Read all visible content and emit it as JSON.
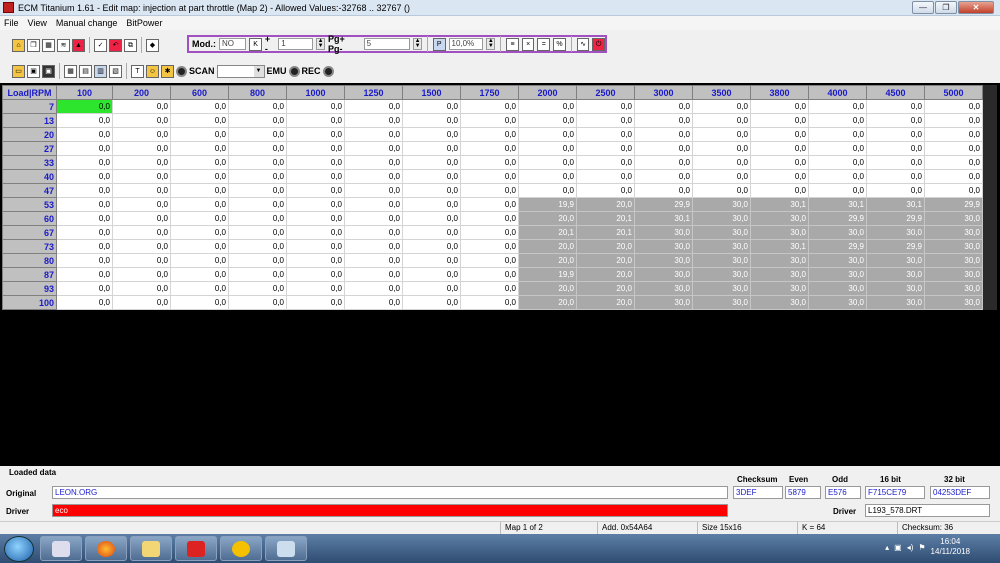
{
  "window": {
    "title": "ECM Titanium 1.61 - Edit map: injection at part throttle (Map 2) - Allowed Values:-32768 .. 32767 ()",
    "minimize": "—",
    "maximize": "❐",
    "close": "✕"
  },
  "menu": [
    "File",
    "View",
    "Manual change",
    "BitPower"
  ],
  "toolbar1": {
    "mod_label": "Mod.:",
    "mod_value": "NO",
    "k_label": "K",
    "plusminus_label": "+ -",
    "plusminus_value": "1",
    "pg_label": "Pg+ Pg-",
    "pg_value": "5",
    "p_label": "P",
    "percent_value": "10,0%"
  },
  "toolbar2": {
    "scan_label": "SCAN",
    "scan_value": "",
    "emu_label": "EMU",
    "rec_label": "REC"
  },
  "table": {
    "corner": "Load|RPM",
    "rpm": [
      "100",
      "200",
      "600",
      "800",
      "1000",
      "1250",
      "1500",
      "1750",
      "2000",
      "2500",
      "3000",
      "3500",
      "3800",
      "4000",
      "4500",
      "5000"
    ],
    "rows": [
      {
        "load": "7",
        "values": [
          "0,0",
          "0,0",
          "0,0",
          "0,0",
          "0,0",
          "0,0",
          "0,0",
          "0,0",
          "0,0",
          "0,0",
          "0,0",
          "0,0",
          "0,0",
          "0,0",
          "0,0",
          "0,0"
        ]
      },
      {
        "load": "13",
        "values": [
          "0,0",
          "0,0",
          "0,0",
          "0,0",
          "0,0",
          "0,0",
          "0,0",
          "0,0",
          "0,0",
          "0,0",
          "0,0",
          "0,0",
          "0,0",
          "0,0",
          "0,0",
          "0,0"
        ]
      },
      {
        "load": "20",
        "values": [
          "0,0",
          "0,0",
          "0,0",
          "0,0",
          "0,0",
          "0,0",
          "0,0",
          "0,0",
          "0,0",
          "0,0",
          "0,0",
          "0,0",
          "0,0",
          "0,0",
          "0,0",
          "0,0"
        ]
      },
      {
        "load": "27",
        "values": [
          "0,0",
          "0,0",
          "0,0",
          "0,0",
          "0,0",
          "0,0",
          "0,0",
          "0,0",
          "0,0",
          "0,0",
          "0,0",
          "0,0",
          "0,0",
          "0,0",
          "0,0",
          "0,0"
        ]
      },
      {
        "load": "33",
        "values": [
          "0,0",
          "0,0",
          "0,0",
          "0,0",
          "0,0",
          "0,0",
          "0,0",
          "0,0",
          "0,0",
          "0,0",
          "0,0",
          "0,0",
          "0,0",
          "0,0",
          "0,0",
          "0,0"
        ]
      },
      {
        "load": "40",
        "values": [
          "0,0",
          "0,0",
          "0,0",
          "0,0",
          "0,0",
          "0,0",
          "0,0",
          "0,0",
          "0,0",
          "0,0",
          "0,0",
          "0,0",
          "0,0",
          "0,0",
          "0,0",
          "0,0"
        ]
      },
      {
        "load": "47",
        "values": [
          "0,0",
          "0,0",
          "0,0",
          "0,0",
          "0,0",
          "0,0",
          "0,0",
          "0,0",
          "0,0",
          "0,0",
          "0,0",
          "0,0",
          "0,0",
          "0,0",
          "0,0",
          "0,0"
        ]
      },
      {
        "load": "53",
        "values": [
          "0,0",
          "0,0",
          "0,0",
          "0,0",
          "0,0",
          "0,0",
          "0,0",
          "0,0",
          "19,9",
          "20,0",
          "29,9",
          "30,0",
          "30,1",
          "30,1",
          "30,1",
          "29,9"
        ]
      },
      {
        "load": "60",
        "values": [
          "0,0",
          "0,0",
          "0,0",
          "0,0",
          "0,0",
          "0,0",
          "0,0",
          "0,0",
          "20,0",
          "20,1",
          "30,1",
          "30,0",
          "30,0",
          "29,9",
          "29,9",
          "30,0"
        ]
      },
      {
        "load": "67",
        "values": [
          "0,0",
          "0,0",
          "0,0",
          "0,0",
          "0,0",
          "0,0",
          "0,0",
          "0,0",
          "20,1",
          "20,1",
          "30,0",
          "30,0",
          "30,0",
          "30,0",
          "30,0",
          "30,0"
        ]
      },
      {
        "load": "73",
        "values": [
          "0,0",
          "0,0",
          "0,0",
          "0,0",
          "0,0",
          "0,0",
          "0,0",
          "0,0",
          "20,0",
          "20,0",
          "30,0",
          "30,0",
          "30,1",
          "29,9",
          "29,9",
          "30,0"
        ]
      },
      {
        "load": "80",
        "values": [
          "0,0",
          "0,0",
          "0,0",
          "0,0",
          "0,0",
          "0,0",
          "0,0",
          "0,0",
          "20,0",
          "20,0",
          "30,0",
          "30,0",
          "30,0",
          "30,0",
          "30,0",
          "30,0"
        ]
      },
      {
        "load": "87",
        "values": [
          "0,0",
          "0,0",
          "0,0",
          "0,0",
          "0,0",
          "0,0",
          "0,0",
          "0,0",
          "19,9",
          "20,0",
          "30,0",
          "30,0",
          "30,0",
          "30,0",
          "30,0",
          "30,0"
        ]
      },
      {
        "load": "93",
        "values": [
          "0,0",
          "0,0",
          "0,0",
          "0,0",
          "0,0",
          "0,0",
          "0,0",
          "0,0",
          "20,0",
          "20,0",
          "30,0",
          "30,0",
          "30,0",
          "30,0",
          "30,0",
          "30,0"
        ]
      },
      {
        "load": "100",
        "values": [
          "0,0",
          "0,0",
          "0,0",
          "0,0",
          "0,0",
          "0,0",
          "0,0",
          "0,0",
          "20,0",
          "20,0",
          "30,0",
          "30,0",
          "30,0",
          "30,0",
          "30,0",
          "30,0"
        ]
      }
    ]
  },
  "loaded": {
    "section_label": "Loaded data",
    "original_label": "Original",
    "original_value": "LEON.ORG",
    "driver_label": "Driver",
    "driver_value": "eco",
    "checksum_label": "Checksum",
    "checksum_value": "3DEF",
    "even_label": "Even",
    "even_value": "5879",
    "odd_label": "Odd",
    "odd_value": "E576",
    "bit16_label": "16 bit",
    "bit16_value": "F715CE79",
    "bit32_label": "32 bit",
    "bit32_value": "04253DEF",
    "driver2_label": "Driver",
    "driver2_value": "L193_578.DRT"
  },
  "status": {
    "map": "Map 1 of 2",
    "addr": "Add. 0x54A64",
    "size": "Size 15x16",
    "k": "K = 64",
    "checksum": "Checksum: 36"
  },
  "taskbar": {
    "time": "16:04",
    "date": "14/11/2018"
  },
  "colors": {
    "selected_cell": "#2ee52e",
    "modified_cell": "#a9a9a9",
    "header_text": "#1a1acc",
    "driver_bar": "#ff0000",
    "mod_box_border": "#a050c0"
  }
}
